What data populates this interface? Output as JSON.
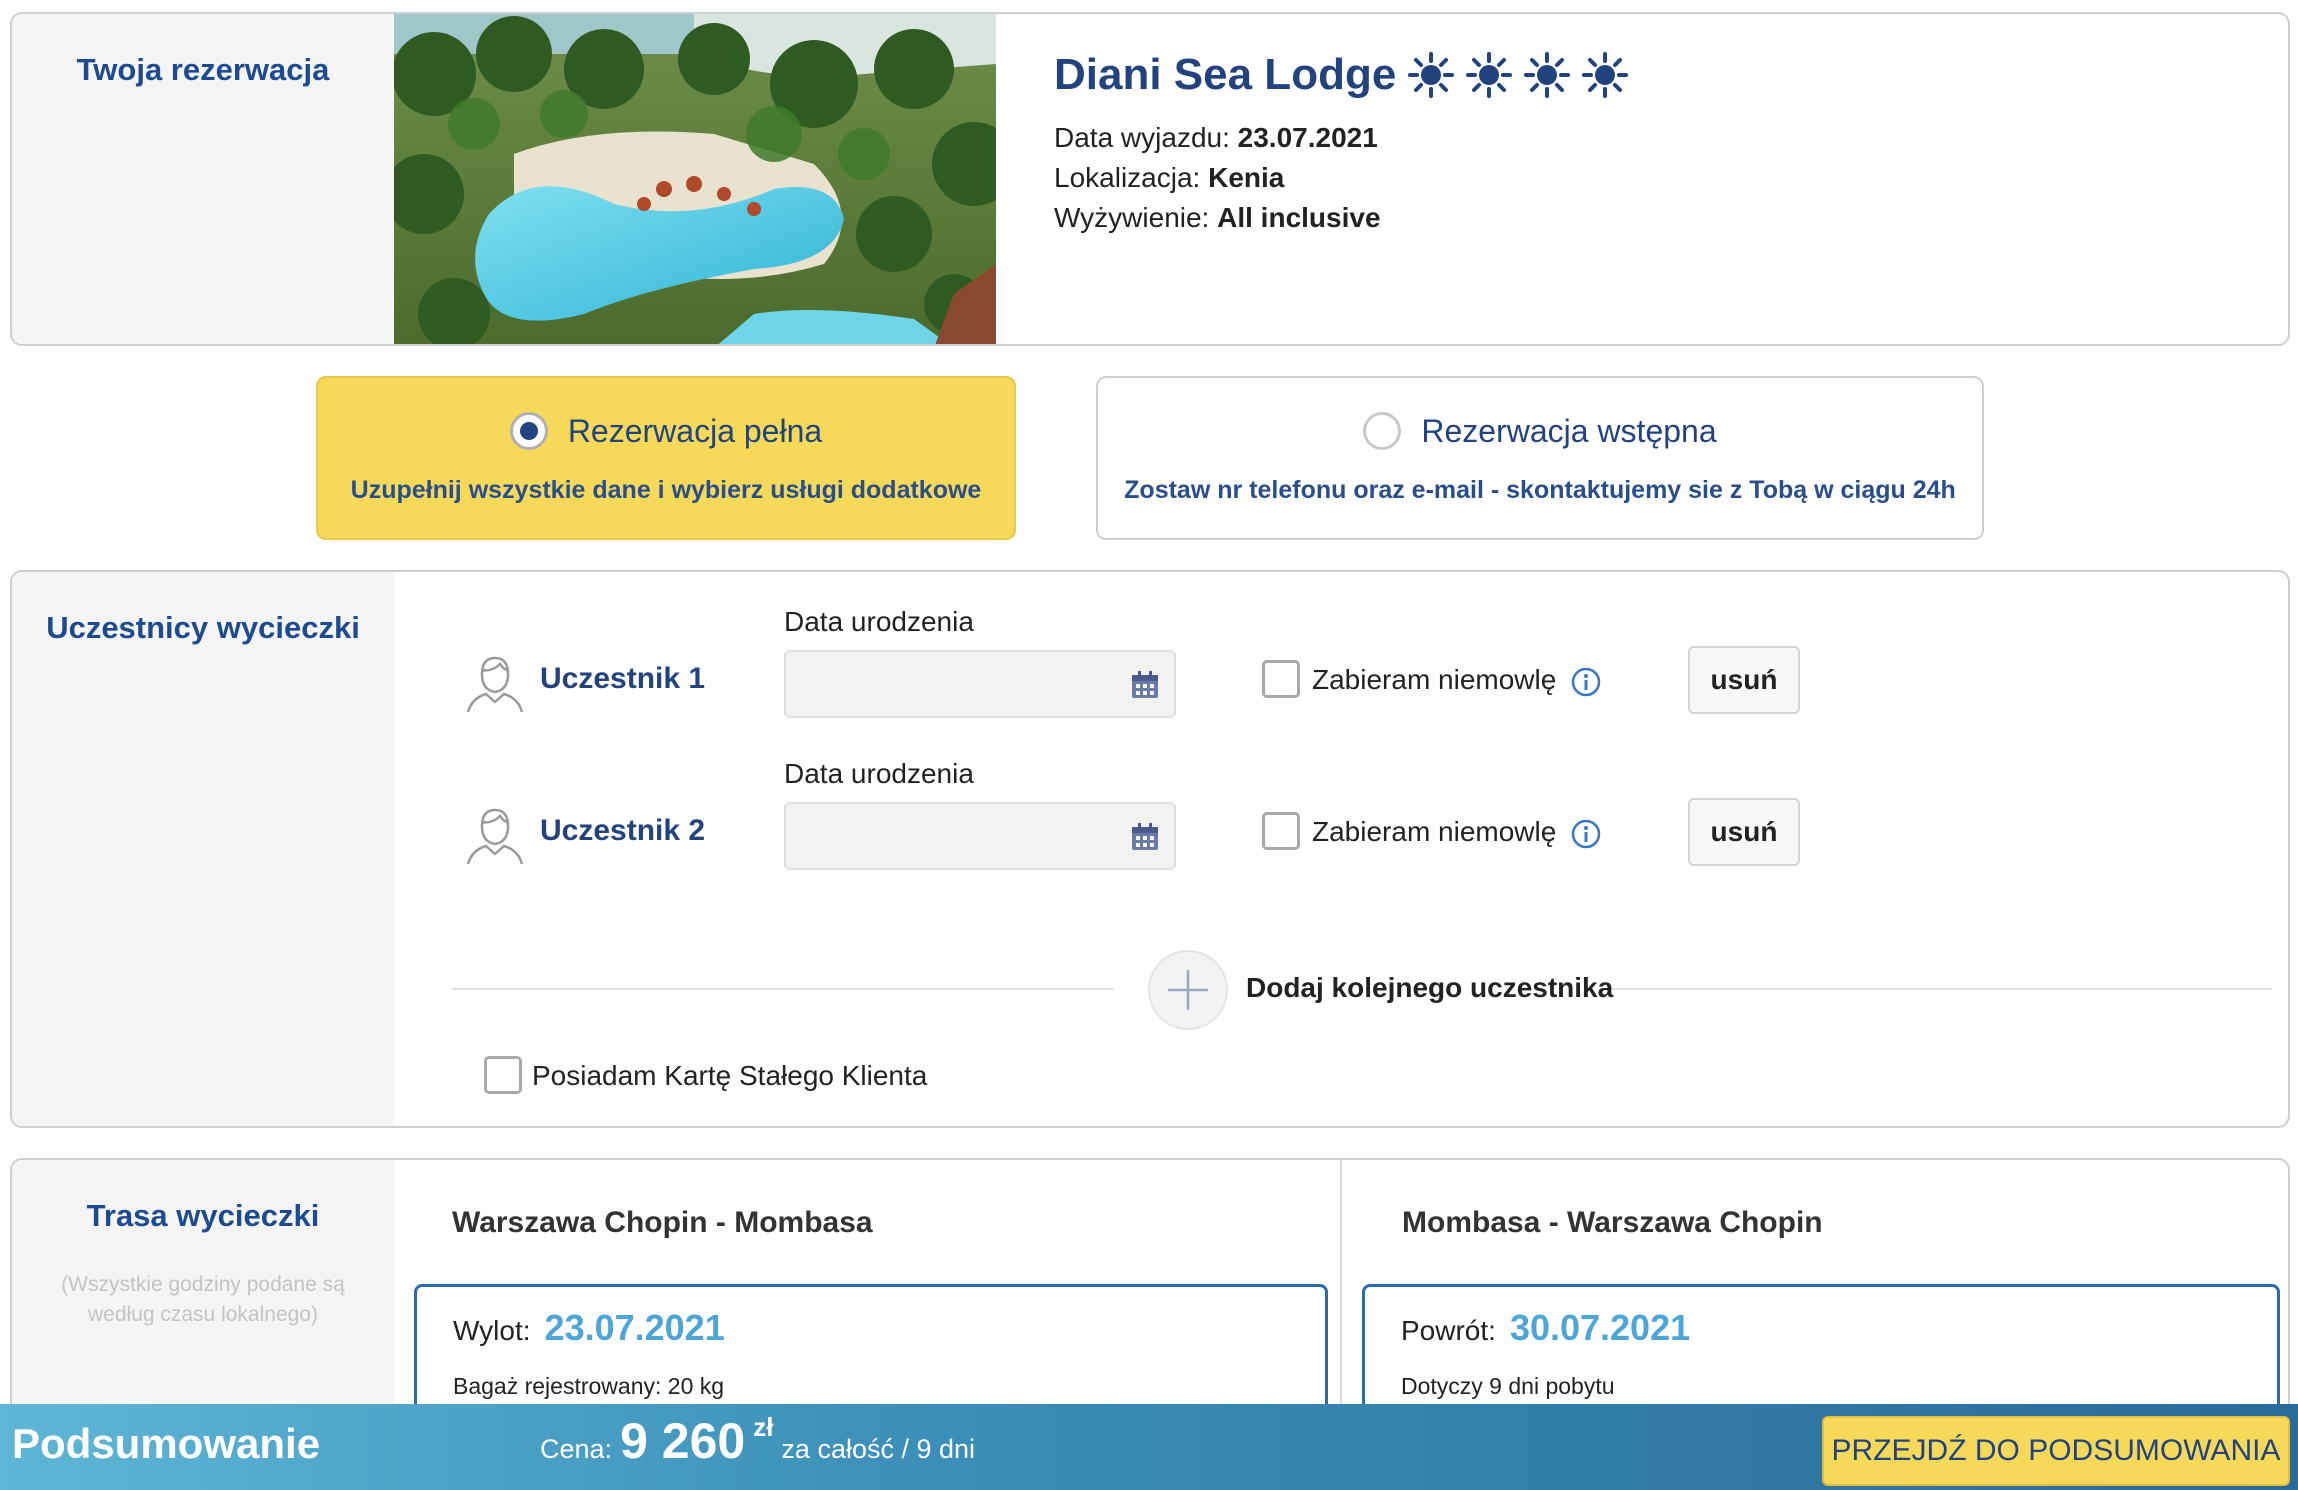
{
  "reservation": {
    "section_title": "Twoja rezerwacja",
    "hotel_name": "Diani Sea Lodge",
    "stars": 4,
    "departure_label": "Data wyjazdu:",
    "departure_value": "23.07.2021",
    "location_label": "Lokalizacja:",
    "location_value": "Kenia",
    "board_label": "Wyżywienie:",
    "board_value": "All inclusive"
  },
  "options": {
    "full": {
      "title": "Rezerwacja pełna",
      "subtitle": "Uzupełnij wszystkie dane i wybierz usługi dodatkowe",
      "selected": true
    },
    "preliminary": {
      "title": "Rezerwacja wstępna",
      "subtitle": "Zostaw nr telefonu oraz e-mail - skontaktujemy sie z Tobą w ciągu 24h",
      "selected": false
    }
  },
  "participants": {
    "section_title": "Uczestnicy wycieczki",
    "items": [
      {
        "name": "Uczestnik 1",
        "birth_label": "Data urodzenia",
        "birth_value": "",
        "infant_label": "Zabieram niemowlę",
        "infant_checked": false,
        "remove_label": "usuń"
      },
      {
        "name": "Uczestnik 2",
        "birth_label": "Data urodzenia",
        "birth_value": "",
        "infant_label": "Zabieram niemowlę",
        "infant_checked": false,
        "remove_label": "usuń"
      }
    ],
    "add_label": "Dodaj kolejnego uczestnika",
    "loyalty_label": "Posiadam Kartę Stałego Klienta",
    "loyalty_checked": false
  },
  "route": {
    "section_title": "Trasa wycieczki",
    "note": "(Wszystkie godziny podane są według czasu lokalnego)",
    "outbound": {
      "title": "Warszawa Chopin - Mombasa",
      "label": "Wylot:",
      "date": "23.07.2021",
      "note": "Bagaż rejestrowany: 20 kg"
    },
    "return": {
      "title": "Mombasa - Warszawa Chopin",
      "label": "Powrót:",
      "date": "30.07.2021",
      "note": "Dotyczy 9 dni pobytu"
    }
  },
  "summary": {
    "title": "Podsumowanie",
    "price_label": "Cena:",
    "price_value": "9 260",
    "currency": "zł",
    "price_desc": "za całość / 9 dni",
    "cta": "PRZEJDŹ DO PODSUMOWANIA"
  },
  "colors": {
    "brand_navy": "#23437f",
    "accent_yellow": "#f7d95a",
    "date_blue": "#4da6d6"
  }
}
